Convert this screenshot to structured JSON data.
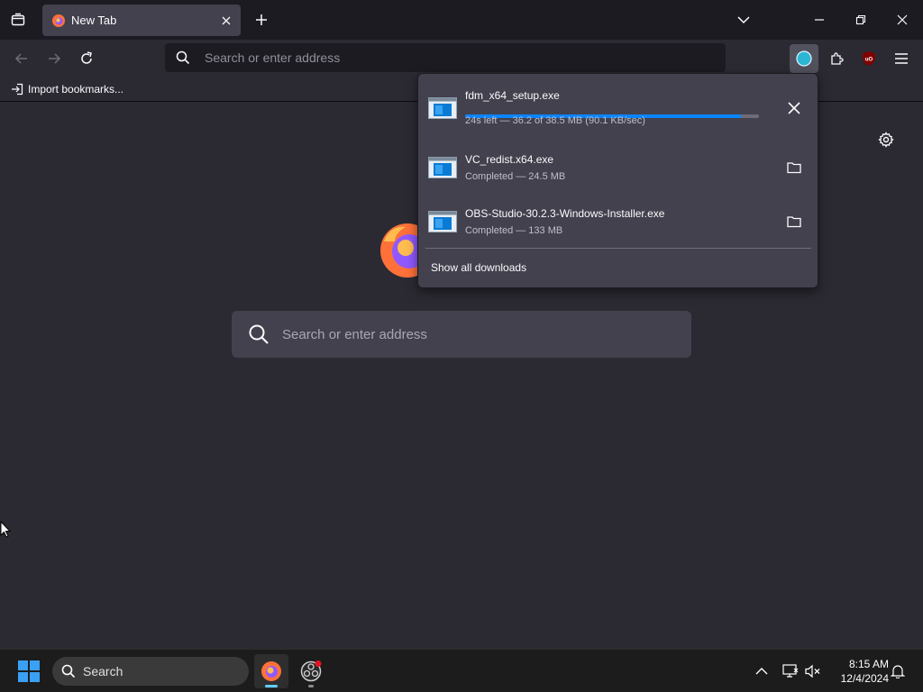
{
  "tab": {
    "title": "New Tab"
  },
  "urlbar": {
    "placeholder": "Search or enter address"
  },
  "bookmarks": {
    "import_label": "Import bookmarks..."
  },
  "content": {
    "search_placeholder": "Search or enter address"
  },
  "downloads": {
    "items": [
      {
        "name": "fdm_x64_setup.exe",
        "status": "24s left — 36.2 of 38.5 MB (90.1 KB/sec)",
        "progress": 0.94,
        "action": "cancel-icon"
      },
      {
        "name": "VC_redist.x64.exe",
        "status": "Completed — 24.5 MB",
        "action": "folder-icon"
      },
      {
        "name": "OBS-Studio-30.2.3-Windows-Installer.exe",
        "status": "Completed — 133 MB",
        "action": "folder-icon"
      }
    ],
    "show_all": "Show all downloads"
  },
  "taskbar": {
    "search_label": "Search",
    "time": "8:15 AM",
    "date": "12/4/2024"
  },
  "colors": {
    "accent": "#0a84ff",
    "background": "#2b2a33",
    "tabstrip": "#1c1b22",
    "panel": "#42414d"
  }
}
